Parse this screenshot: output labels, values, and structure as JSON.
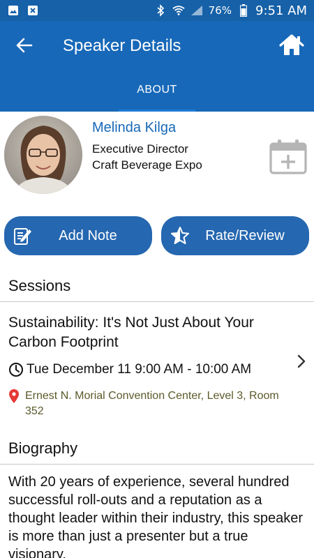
{
  "status_bar": {
    "battery": "76%",
    "time": "9:51 AM"
  },
  "header": {
    "title": "Speaker Details",
    "tab": "ABOUT",
    "back_icon": "arrow-left-icon",
    "home_icon": "home-icon"
  },
  "speaker": {
    "name": "Melinda Kilga",
    "title": "Executive Director",
    "organization": "Craft Beverage Expo"
  },
  "actions": {
    "add_note": "Add Note",
    "rate_review": "Rate/Review"
  },
  "sessions": {
    "header": "Sessions",
    "items": [
      {
        "title": "Sustainability: It's Not Just About Your Carbon Footprint",
        "time": "Tue December 11 9:00 AM - 10:00 AM",
        "location": "Ernest N. Morial Convention Center, Level 3, Room 352"
      }
    ]
  },
  "biography": {
    "header": "Biography",
    "text": "With 20 years of experience, several hundred successful roll-outs and a reputation as a thought leader within their industry, this speaker is more than just a presenter but a true visionary."
  },
  "colors": {
    "app_bar": "#1768b8",
    "status_bar": "#1661a8",
    "button": "#2567b0",
    "speaker_name": "#1768b8",
    "location_text": "#5c5a2a",
    "location_pin": "#e53935"
  }
}
